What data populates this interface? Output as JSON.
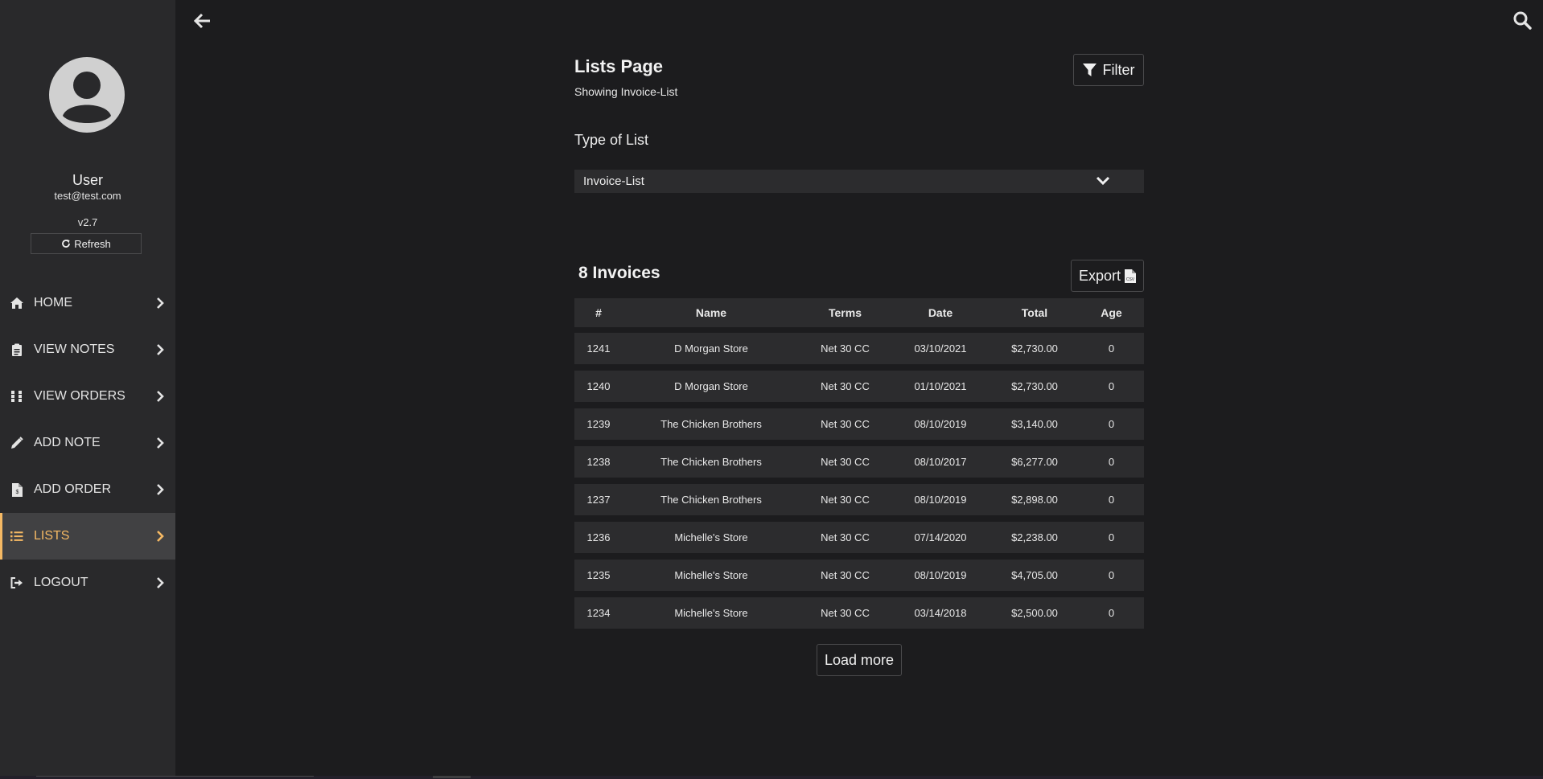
{
  "user": {
    "name": "User",
    "email": "test@test.com",
    "version": "v2.7",
    "refresh_label": "Refresh"
  },
  "nav": {
    "items": [
      {
        "label": "HOME",
        "icon": "home-icon"
      },
      {
        "label": "VIEW NOTES",
        "icon": "clipboard-icon"
      },
      {
        "label": "VIEW ORDERS",
        "icon": "grid-icon"
      },
      {
        "label": "ADD NOTE",
        "icon": "pencil-icon"
      },
      {
        "label": "ADD ORDER",
        "icon": "file-invoice-icon"
      },
      {
        "label": "LISTS",
        "icon": "list-icon",
        "active": true
      },
      {
        "label": "LOGOUT",
        "icon": "sign-out-icon"
      }
    ]
  },
  "header": {
    "title": "Lists Page",
    "subtitle": "Showing Invoice-List",
    "filter_label": "Filter"
  },
  "list_type": {
    "label": "Type of List",
    "selected": "Invoice-List"
  },
  "invoices": {
    "count_title": "8 Invoices",
    "export_label": "Export",
    "columns": [
      "#",
      "Name",
      "Terms",
      "Date",
      "Total",
      "Age"
    ],
    "rows": [
      {
        "num": "1241",
        "name": "D Morgan Store",
        "terms": "Net 30 CC",
        "date": "03/10/2021",
        "total": "$2,730.00",
        "age": "0"
      },
      {
        "num": "1240",
        "name": "D Morgan Store",
        "terms": "Net 30 CC",
        "date": "01/10/2021",
        "total": "$2,730.00",
        "age": "0"
      },
      {
        "num": "1239",
        "name": "The Chicken Brothers",
        "terms": "Net 30 CC",
        "date": "08/10/2019",
        "total": "$3,140.00",
        "age": "0"
      },
      {
        "num": "1238",
        "name": "The Chicken Brothers",
        "terms": "Net 30 CC",
        "date": "08/10/2017",
        "total": "$6,277.00",
        "age": "0"
      },
      {
        "num": "1237",
        "name": "The Chicken Brothers",
        "terms": "Net 30 CC",
        "date": "08/10/2019",
        "total": "$2,898.00",
        "age": "0"
      },
      {
        "num": "1236",
        "name": "Michelle's Store",
        "terms": "Net 30 CC",
        "date": "07/14/2020",
        "total": "$2,238.00",
        "age": "0"
      },
      {
        "num": "1235",
        "name": "Michelle's Store",
        "terms": "Net 30 CC",
        "date": "08/10/2019",
        "total": "$4,705.00",
        "age": "0"
      },
      {
        "num": "1234",
        "name": "Michelle's Store",
        "terms": "Net 30 CC",
        "date": "03/14/2018",
        "total": "$2,500.00",
        "age": "0"
      }
    ],
    "load_more_label": "Load more"
  },
  "colors": {
    "background": "#1c1c1e",
    "sidebar": "#29292b",
    "accent": "#f5b964",
    "row": "#2c2c2e"
  }
}
